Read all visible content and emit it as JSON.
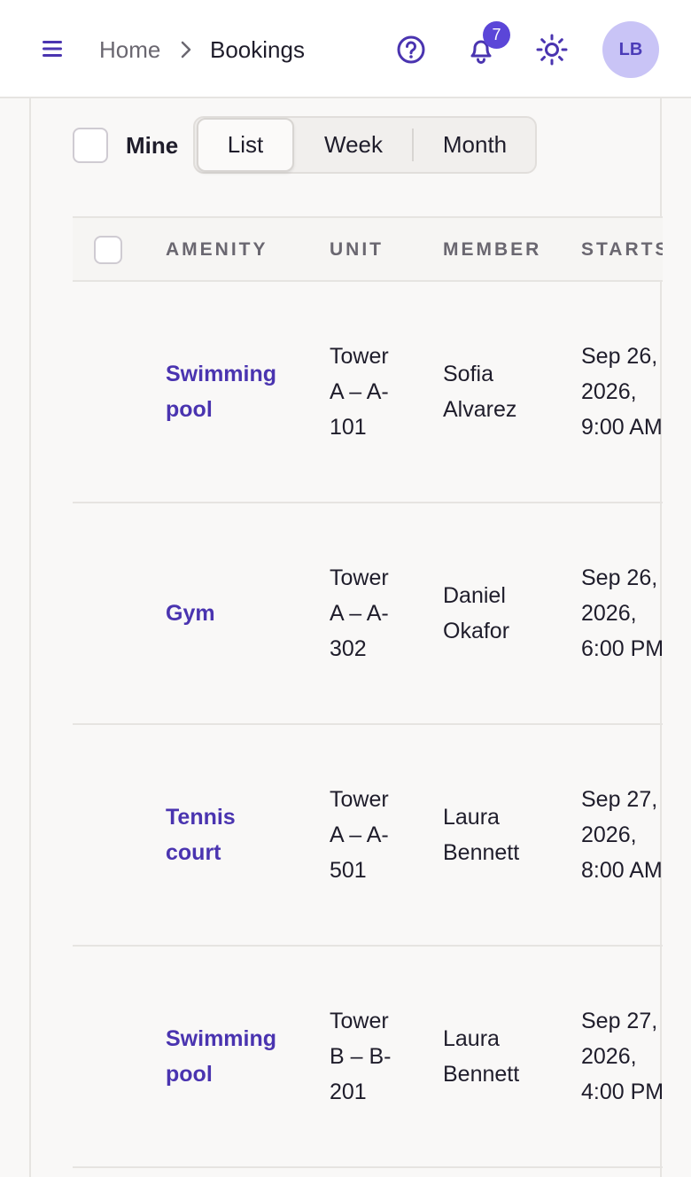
{
  "header": {
    "breadcrumb_home": "Home",
    "breadcrumb_current": "Bookings",
    "notification_count": "7",
    "avatar_initials": "LB",
    "icons": [
      "menu-icon",
      "chevron-right-icon",
      "help-icon",
      "bell-icon",
      "sun-icon"
    ]
  },
  "filters": {
    "mine_label": "Mine",
    "views": [
      "List",
      "Week",
      "Month"
    ],
    "active_view": "List"
  },
  "table": {
    "columns": [
      "AMENITY",
      "UNIT",
      "MEMBER",
      "STARTS"
    ],
    "rows": [
      {
        "amenity": [
          "Swimming",
          "pool"
        ],
        "unit": [
          "Tower",
          "A – A-",
          "101"
        ],
        "member": [
          "Sofia",
          "Alvarez"
        ],
        "starts": [
          "Sep 26,",
          "2026,",
          "9:00 AM"
        ]
      },
      {
        "amenity": [
          "Gym"
        ],
        "unit": [
          "Tower",
          "A – A-",
          "302"
        ],
        "member": [
          "Daniel",
          "Okafor"
        ],
        "starts": [
          "Sep 26,",
          "2026,",
          "6:00 PM"
        ]
      },
      {
        "amenity": [
          "Tennis",
          "court"
        ],
        "unit": [
          "Tower",
          "A – A-",
          "501"
        ],
        "member": [
          "Laura",
          "Bennett"
        ],
        "starts": [
          "Sep 27,",
          "2026,",
          "8:00 AM"
        ]
      },
      {
        "amenity": [
          "Swimming",
          "pool"
        ],
        "unit": [
          "Tower",
          "B – B-",
          "201"
        ],
        "member": [
          "Laura",
          "Bennett"
        ],
        "starts": [
          "Sep 27,",
          "2026,",
          "4:00 PM"
        ]
      }
    ]
  },
  "colors": {
    "accent": "#5b46d8",
    "link": "#4a34b0",
    "avatar_bg": "#c9c4f6",
    "background": "#f9f8f7"
  }
}
